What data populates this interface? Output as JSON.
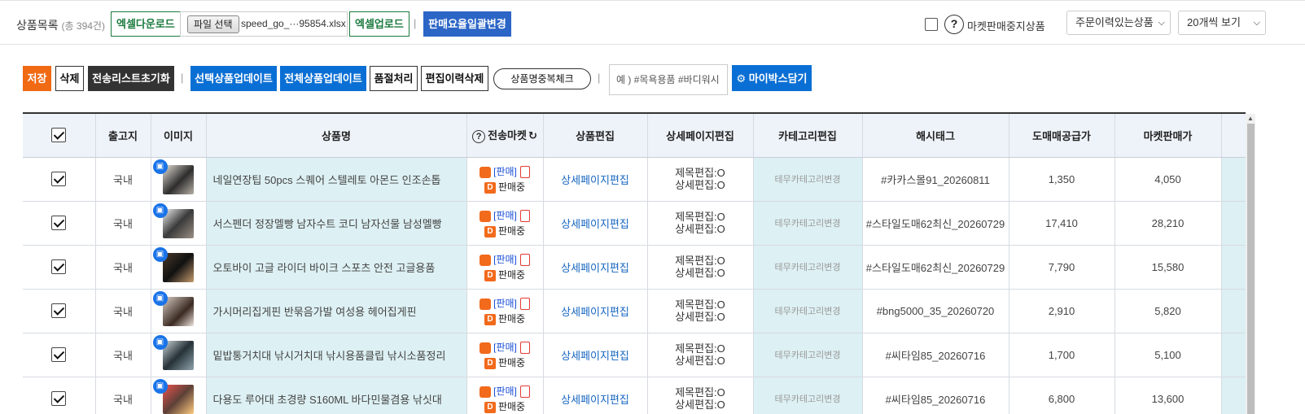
{
  "header": {
    "title": "상품목록",
    "count_text": "(총 394건)",
    "excel_download_label": "엑셀다운로드",
    "file_select_label": "파일 선택",
    "file_name": "speed_go_···95854.xlsx",
    "excel_upload_label": "엑셀업로드",
    "separator": "|",
    "bulk_rate_label": "판매요율일괄변경",
    "stopped_help": "?",
    "stopped_label": "마켓판매중지상품",
    "order_filter": "주문이력있는상품",
    "page_size": "20개씩 보기"
  },
  "actions": {
    "save": "저장",
    "delete": "삭제",
    "reset_list": "전송리스트초기화",
    "update_selected": "선택상품업데이트",
    "update_all": "전체상품업데이트",
    "soldout": "품절처리",
    "delete_history": "편집이력삭제",
    "dup_check": "상품명중복체크",
    "tag_placeholder": "예 ) #목욕용품 #바디워시",
    "mybox": "마이박스담기"
  },
  "table": {
    "headers": {
      "warehouse": "출고지",
      "image": "이미지",
      "name": "상품명",
      "market_help": "?",
      "market": "전송마켓",
      "product_edit": "상품편집",
      "detail_edit": "상세페이지편집",
      "category_edit": "카테고리편집",
      "hashtag": "해시태그",
      "wholesale": "도매매공급가",
      "market_price": "마켓판매가"
    },
    "rows": [
      {
        "warehouse": "국내",
        "name": "네일연장팁 50pcs 스퀘어 스텔레토 아몬드 인조손톱",
        "sell_tag": "[판매]",
        "status": "판매중",
        "detail_link": "상세페이지편집",
        "edit_title": "제목편집:O",
        "edit_detail": "상세편집:O",
        "category": "테무카테고리변경",
        "hashtag": "#카카스몰91_20260811",
        "wholesale": "1,350",
        "market_price": "4,050"
      },
      {
        "warehouse": "국내",
        "name": "서스펜더 정장멜빵 남자수트 코디 남자선물 남성멜빵",
        "sell_tag": "[판매]",
        "status": "판매중",
        "detail_link": "상세페이지편집",
        "edit_title": "제목편집:O",
        "edit_detail": "상세편집:O",
        "category": "테무카테고리변경",
        "hashtag": "#스타일도매62최신_20260729",
        "wholesale": "17,410",
        "market_price": "28,210"
      },
      {
        "warehouse": "국내",
        "name": "오토바이 고글 라이더 바이크 스포츠 안전 고글용품",
        "sell_tag": "[판매]",
        "status": "판매중",
        "detail_link": "상세페이지편집",
        "edit_title": "제목편집:O",
        "edit_detail": "상세편집:O",
        "category": "테무카테고리변경",
        "hashtag": "#스타일도매62최신_20260729",
        "wholesale": "7,790",
        "market_price": "15,580"
      },
      {
        "warehouse": "국내",
        "name": "가시머리집게핀 반묶음가발 여성용 헤어집게핀",
        "sell_tag": "[판매]",
        "status": "판매중",
        "detail_link": "상세페이지편집",
        "edit_title": "제목편집:O",
        "edit_detail": "상세편집:O",
        "category": "테무카테고리변경",
        "hashtag": "#bng5000_35_20260720",
        "wholesale": "2,910",
        "market_price": "5,820"
      },
      {
        "warehouse": "국내",
        "name": "밑밥통거치대 낚시거치대 낚시용품클립 낚시소품정리",
        "sell_tag": "[판매]",
        "status": "판매중",
        "detail_link": "상세페이지편집",
        "edit_title": "제목편집:O",
        "edit_detail": "상세편집:O",
        "category": "테무카테고리변경",
        "hashtag": "#씨타임85_20260716",
        "wholesale": "1,700",
        "market_price": "5,100"
      },
      {
        "warehouse": "국내",
        "name": "다용도 루어대 초경량 S160ML 바다민물겸용 낚싯대",
        "sell_tag": "[판매]",
        "status": "판매중",
        "detail_link": "상세페이지편집",
        "edit_title": "제목편집:O",
        "edit_detail": "상세편집:O",
        "category": "테무카테고리변경",
        "hashtag": "#씨타임85_20260716",
        "wholesale": "6,800",
        "market_price": "13,600"
      }
    ]
  },
  "colors": {
    "orange": "#f06a14",
    "blue": "#0a6fd4",
    "green": "#1b7a3e",
    "row_teal": "#ddf0f3"
  }
}
